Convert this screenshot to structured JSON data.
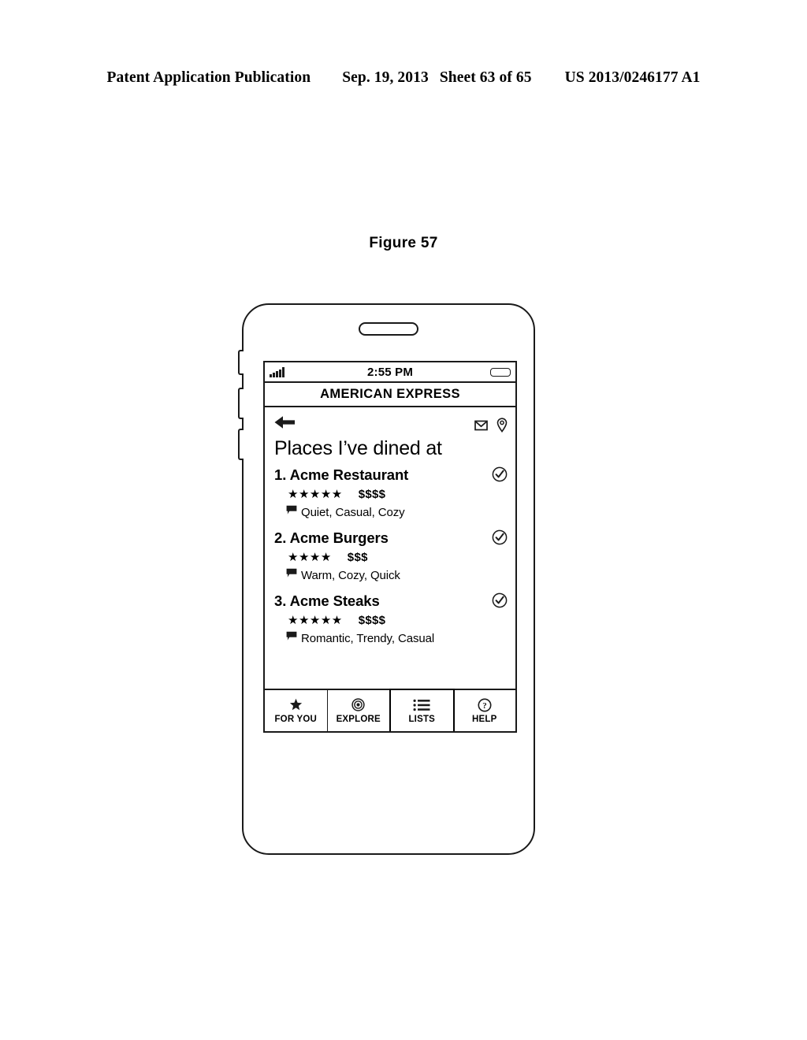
{
  "patent_header": {
    "publication": "Patent Application Publication",
    "date": "Sep. 19, 2013",
    "sheet": "Sheet 63 of 65",
    "number": "US 2013/0246177 A1"
  },
  "figure": {
    "caption": "Figure 57"
  },
  "phone": {
    "status_bar": {
      "time": "2:55 PM",
      "signal_icon": "signal-bars-icon",
      "battery_icon": "battery-icon"
    },
    "app_title": "AMERICAN EXPRESS",
    "nav": {
      "back_icon": "back-arrow-icon",
      "mail_icon": "envelope-icon",
      "location_icon": "map-pin-icon"
    },
    "heading": "Places I’ve dined at",
    "places": [
      {
        "name": "1. Acme Restaurant",
        "stars": "★★★★★",
        "star_count": 5,
        "price": "$$$$",
        "price_level": 4,
        "tags": "Quiet, Casual, Cozy",
        "tag_icon": "comment-icon",
        "check_icon": "check-circle-icon"
      },
      {
        "name": "2. Acme Burgers",
        "stars": "★★★★",
        "star_count": 4,
        "price": "$$$",
        "price_level": 3,
        "tags": "Warm, Cozy, Quick",
        "tag_icon": "comment-icon",
        "check_icon": "check-circle-icon"
      },
      {
        "name": "3. Acme Steaks",
        "stars": "★★★★★",
        "star_count": 5,
        "price": "$$$$",
        "price_level": 4,
        "tags": "Romantic, Trendy, Casual",
        "tag_icon": "comment-icon",
        "check_icon": "check-circle-icon"
      }
    ],
    "tabs": [
      {
        "label": "FOR YOU",
        "icon": "star-icon",
        "active": false
      },
      {
        "label": "EXPLORE",
        "icon": "target-circle-icon",
        "active": false
      },
      {
        "label": "LISTS",
        "icon": "list-icon",
        "active": true
      },
      {
        "label": "HELP",
        "icon": "question-circle-icon",
        "active": false
      }
    ]
  },
  "colors": {
    "ink": "#1a1a1a",
    "paper": "#ffffff"
  }
}
